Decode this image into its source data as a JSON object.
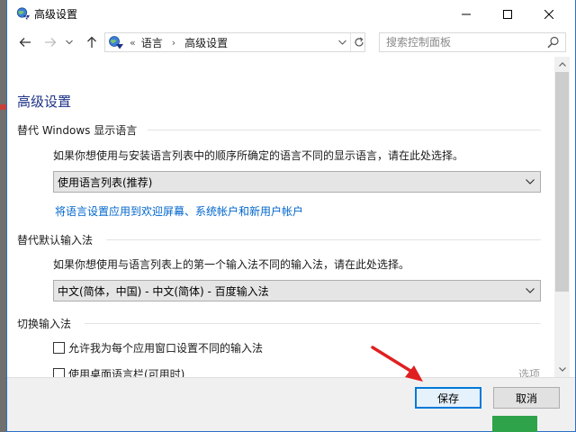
{
  "window": {
    "title": "高级设置"
  },
  "navigation": {
    "address_prefix": "«",
    "breadcrumbs": [
      "语言",
      "高级设置"
    ],
    "search_placeholder": "搜索控制面板"
  },
  "content": {
    "page_title": "高级设置",
    "display_language": {
      "heading": "替代 Windows 显示语言",
      "description": "如果你想使用与安装语言列表中的顺序所确定的语言不同的显示语言，请在此处选择。",
      "selected": "使用语言列表(推荐)",
      "link": "将语言设置应用到欢迎屏幕、系统帐户和新用户帐户"
    },
    "default_input": {
      "heading": "替代默认输入法",
      "description": "如果你想使用与语言列表上的第一个输入法不同的输入法，请在此处选择。",
      "selected": "中文(简体，中国) - 中文(简体) - 百度输入法"
    },
    "switch_input": {
      "heading": "切换输入法",
      "option1": "允许我为每个应用窗口设置不同的输入法",
      "option2": "使用桌面语言栏(可用时)",
      "options_link": "选项"
    }
  },
  "footer": {
    "save_label": "保存",
    "cancel_label": "取消"
  },
  "colors": {
    "title_blue": "#1e3287",
    "link_blue": "#0066cc",
    "focus_blue": "#0078d7",
    "annotation_red": "#e02020"
  }
}
